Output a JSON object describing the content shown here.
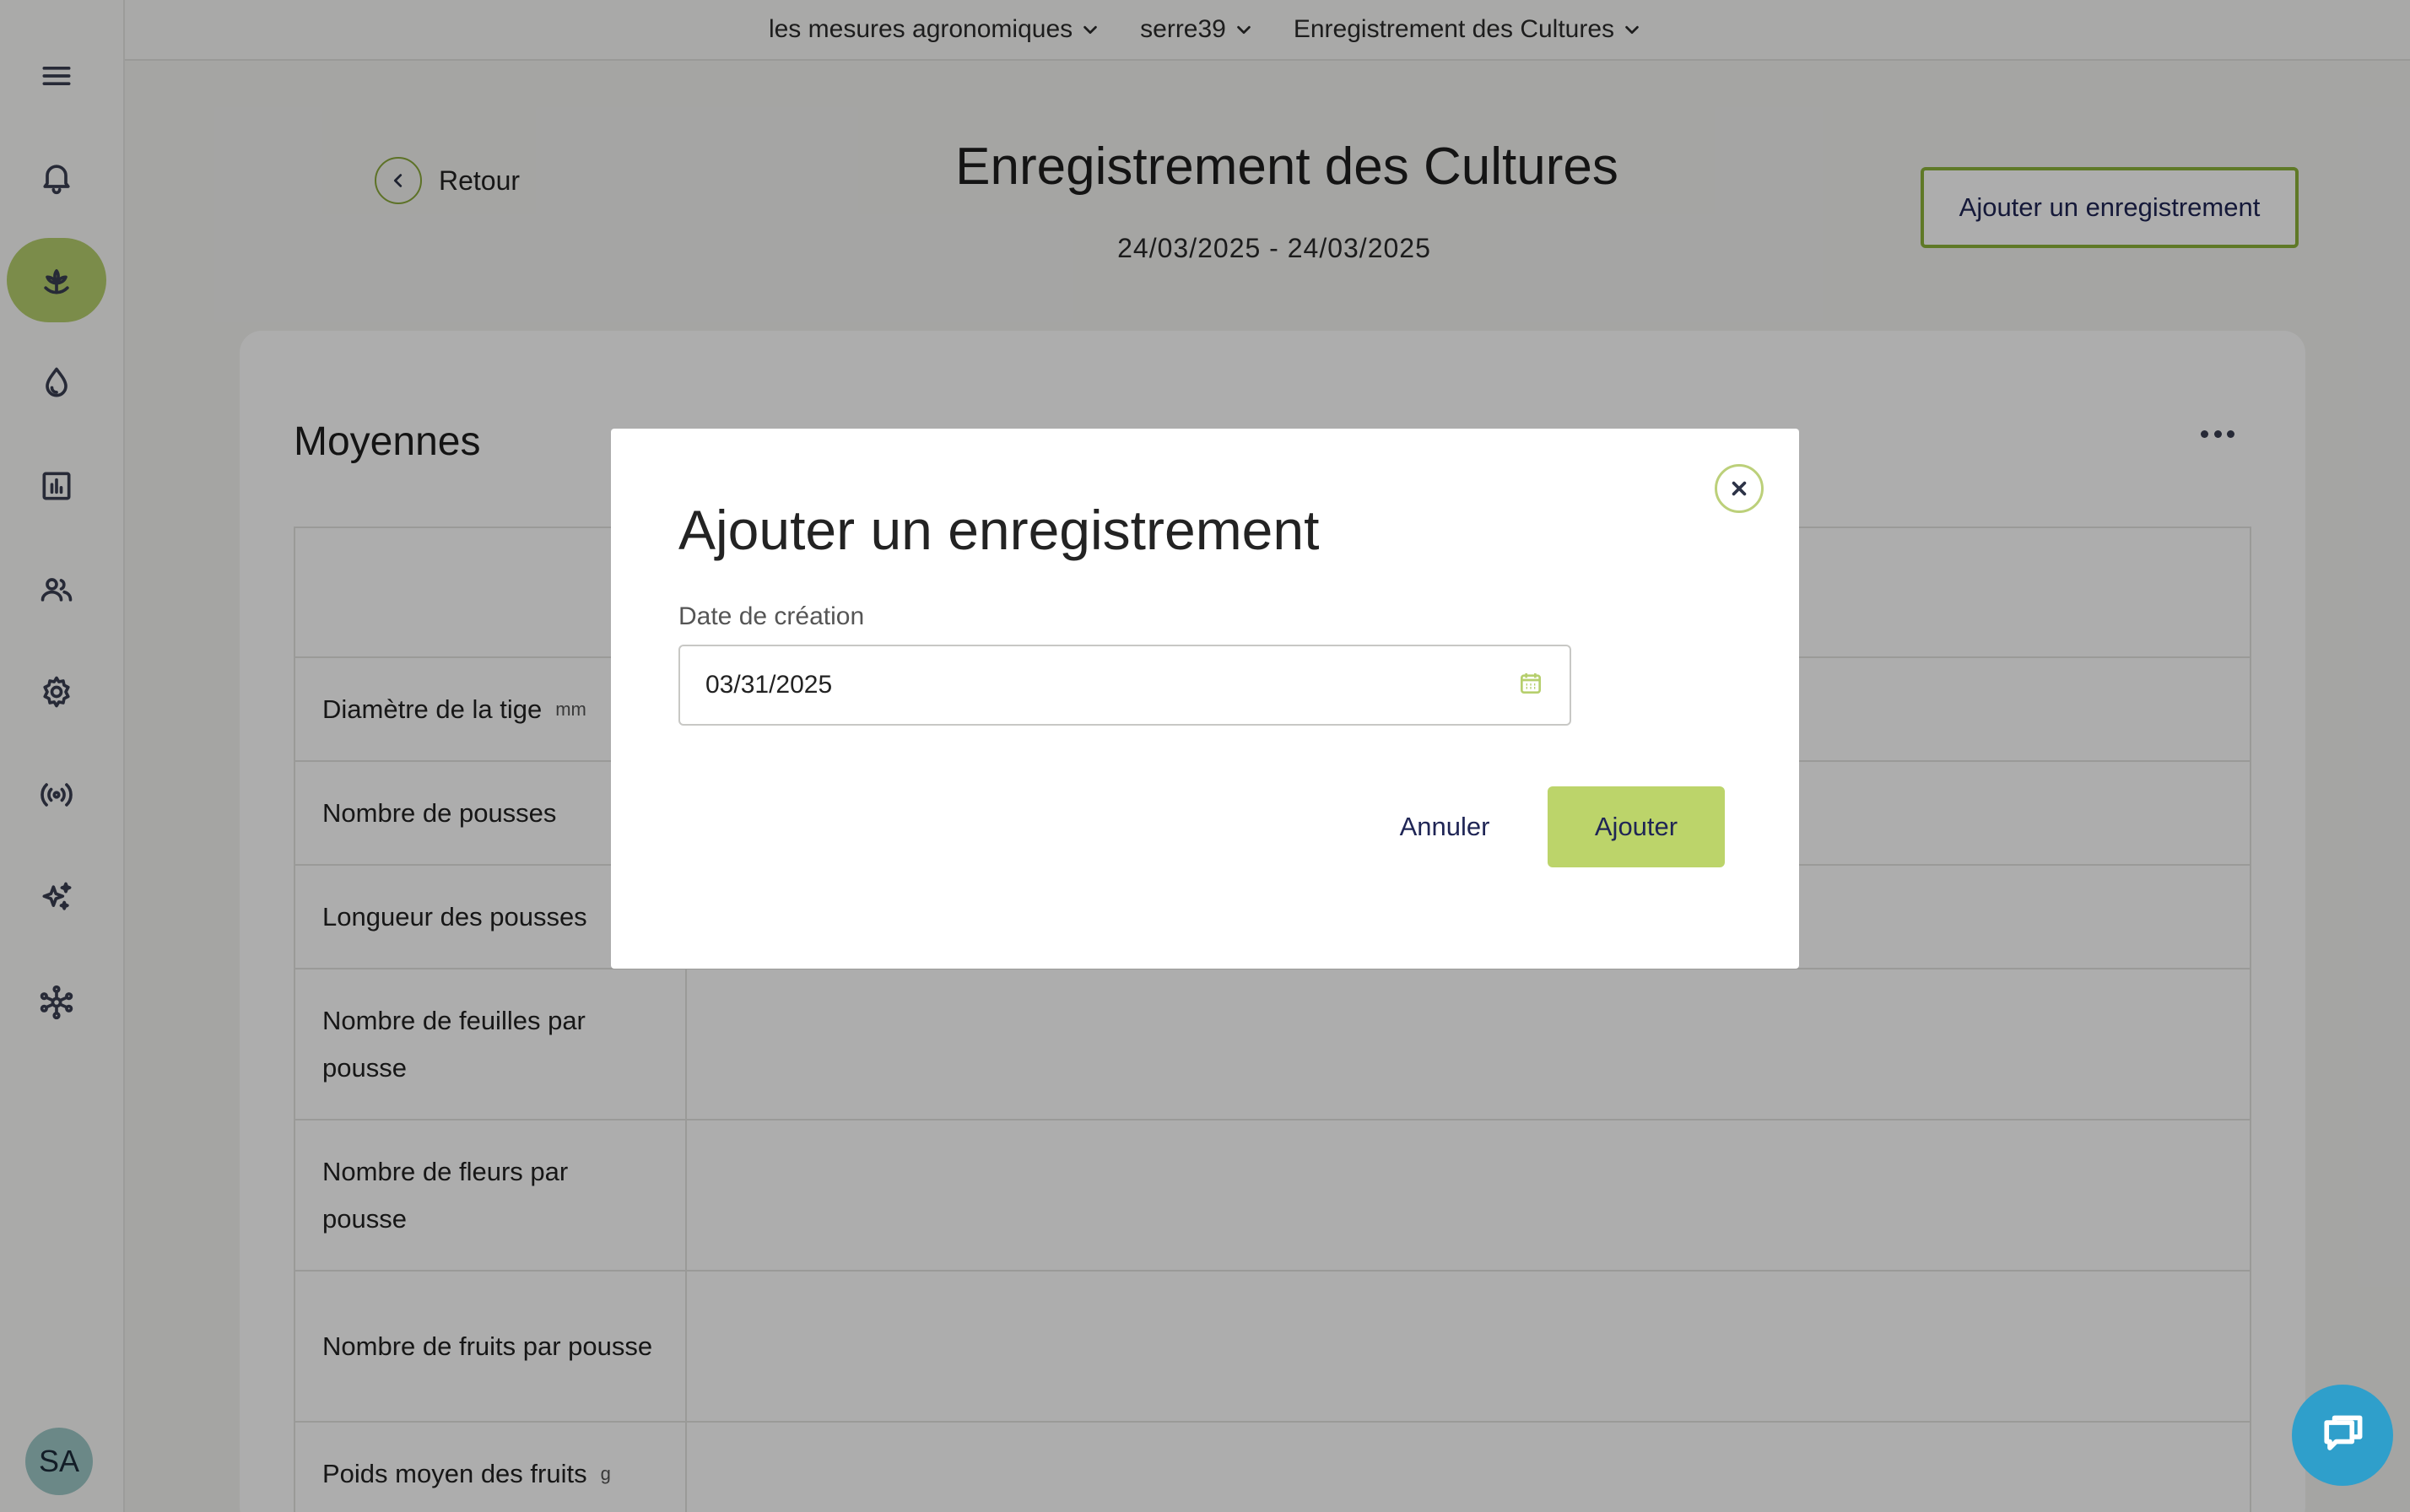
{
  "topbar": {
    "crumbs": [
      "les mesures agronomiques",
      "serre39",
      "Enregistrement des Cultures"
    ]
  },
  "sidebar": {
    "items": [
      {
        "icon": "menu-icon"
      },
      {
        "icon": "bell-icon"
      },
      {
        "icon": "plant-icon",
        "active": true
      },
      {
        "icon": "water-drop-icon"
      },
      {
        "icon": "chart-icon"
      },
      {
        "icon": "users-icon"
      },
      {
        "icon": "gear-icon"
      },
      {
        "icon": "broadcast-icon"
      },
      {
        "icon": "sparkle-icon"
      },
      {
        "icon": "network-icon"
      }
    ],
    "avatar_initials": "SA"
  },
  "header": {
    "back_label": "Retour",
    "title": "Enregistrement des Cultures",
    "date_range": "24/03/2025 - 24/03/2025",
    "add_button": "Ajouter un enregistrement"
  },
  "card": {
    "title": "Moyennes",
    "rows": [
      {
        "label": "Diamètre de la tige",
        "unit": "mm"
      },
      {
        "label": "Nombre de pousses",
        "unit": ""
      },
      {
        "label": "Longueur des pousses",
        "unit": ""
      },
      {
        "label": "Nombre de feuilles par pousse",
        "unit": ""
      },
      {
        "label": "Nombre de fleurs par pousse",
        "unit": ""
      },
      {
        "label": "Nombre de fruits par pousse",
        "unit": ""
      },
      {
        "label": "Poids moyen des fruits",
        "unit": "g"
      }
    ]
  },
  "modal": {
    "title": "Ajouter un enregistrement",
    "field_label": "Date de création",
    "date_value": "03/31/2025",
    "cancel_label": "Annuler",
    "submit_label": "Ajouter"
  },
  "colors": {
    "accent": "#b6cf6d",
    "accent_border": "#8db33a",
    "chat": "#2f9fcb",
    "overlay": "rgba(0,0,0,0.32)"
  }
}
